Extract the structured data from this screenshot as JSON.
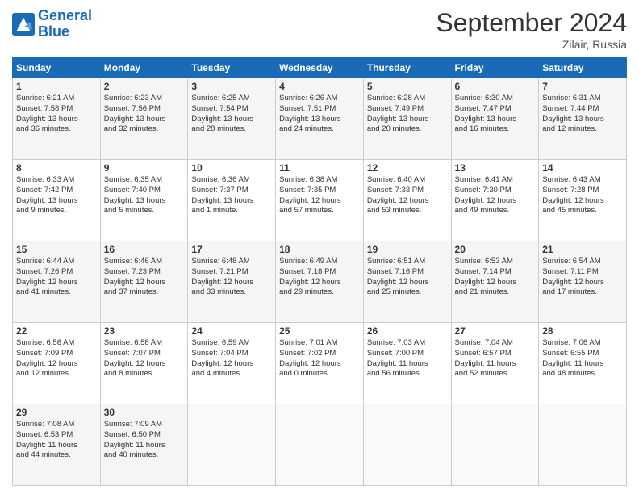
{
  "logo": {
    "line1": "General",
    "line2": "Blue"
  },
  "title": "September 2024",
  "location": "Zilair, Russia",
  "days_header": [
    "Sunday",
    "Monday",
    "Tuesday",
    "Wednesday",
    "Thursday",
    "Friday",
    "Saturday"
  ],
  "weeks": [
    [
      {
        "day": "1",
        "lines": [
          "Sunrise: 6:21 AM",
          "Sunset: 7:58 PM",
          "Daylight: 13 hours",
          "and 36 minutes."
        ]
      },
      {
        "day": "2",
        "lines": [
          "Sunrise: 6:23 AM",
          "Sunset: 7:56 PM",
          "Daylight: 13 hours",
          "and 32 minutes."
        ]
      },
      {
        "day": "3",
        "lines": [
          "Sunrise: 6:25 AM",
          "Sunset: 7:54 PM",
          "Daylight: 13 hours",
          "and 28 minutes."
        ]
      },
      {
        "day": "4",
        "lines": [
          "Sunrise: 6:26 AM",
          "Sunset: 7:51 PM",
          "Daylight: 13 hours",
          "and 24 minutes."
        ]
      },
      {
        "day": "5",
        "lines": [
          "Sunrise: 6:28 AM",
          "Sunset: 7:49 PM",
          "Daylight: 13 hours",
          "and 20 minutes."
        ]
      },
      {
        "day": "6",
        "lines": [
          "Sunrise: 6:30 AM",
          "Sunset: 7:47 PM",
          "Daylight: 13 hours",
          "and 16 minutes."
        ]
      },
      {
        "day": "7",
        "lines": [
          "Sunrise: 6:31 AM",
          "Sunset: 7:44 PM",
          "Daylight: 13 hours",
          "and 12 minutes."
        ]
      }
    ],
    [
      {
        "day": "8",
        "lines": [
          "Sunrise: 6:33 AM",
          "Sunset: 7:42 PM",
          "Daylight: 13 hours",
          "and 9 minutes."
        ]
      },
      {
        "day": "9",
        "lines": [
          "Sunrise: 6:35 AM",
          "Sunset: 7:40 PM",
          "Daylight: 13 hours",
          "and 5 minutes."
        ]
      },
      {
        "day": "10",
        "lines": [
          "Sunrise: 6:36 AM",
          "Sunset: 7:37 PM",
          "Daylight: 13 hours",
          "and 1 minute."
        ]
      },
      {
        "day": "11",
        "lines": [
          "Sunrise: 6:38 AM",
          "Sunset: 7:35 PM",
          "Daylight: 12 hours",
          "and 57 minutes."
        ]
      },
      {
        "day": "12",
        "lines": [
          "Sunrise: 6:40 AM",
          "Sunset: 7:33 PM",
          "Daylight: 12 hours",
          "and 53 minutes."
        ]
      },
      {
        "day": "13",
        "lines": [
          "Sunrise: 6:41 AM",
          "Sunset: 7:30 PM",
          "Daylight: 12 hours",
          "and 49 minutes."
        ]
      },
      {
        "day": "14",
        "lines": [
          "Sunrise: 6:43 AM",
          "Sunset: 7:28 PM",
          "Daylight: 12 hours",
          "and 45 minutes."
        ]
      }
    ],
    [
      {
        "day": "15",
        "lines": [
          "Sunrise: 6:44 AM",
          "Sunset: 7:26 PM",
          "Daylight: 12 hours",
          "and 41 minutes."
        ]
      },
      {
        "day": "16",
        "lines": [
          "Sunrise: 6:46 AM",
          "Sunset: 7:23 PM",
          "Daylight: 12 hours",
          "and 37 minutes."
        ]
      },
      {
        "day": "17",
        "lines": [
          "Sunrise: 6:48 AM",
          "Sunset: 7:21 PM",
          "Daylight: 12 hours",
          "and 33 minutes."
        ]
      },
      {
        "day": "18",
        "lines": [
          "Sunrise: 6:49 AM",
          "Sunset: 7:18 PM",
          "Daylight: 12 hours",
          "and 29 minutes."
        ]
      },
      {
        "day": "19",
        "lines": [
          "Sunrise: 6:51 AM",
          "Sunset: 7:16 PM",
          "Daylight: 12 hours",
          "and 25 minutes."
        ]
      },
      {
        "day": "20",
        "lines": [
          "Sunrise: 6:53 AM",
          "Sunset: 7:14 PM",
          "Daylight: 12 hours",
          "and 21 minutes."
        ]
      },
      {
        "day": "21",
        "lines": [
          "Sunrise: 6:54 AM",
          "Sunset: 7:11 PM",
          "Daylight: 12 hours",
          "and 17 minutes."
        ]
      }
    ],
    [
      {
        "day": "22",
        "lines": [
          "Sunrise: 6:56 AM",
          "Sunset: 7:09 PM",
          "Daylight: 12 hours",
          "and 12 minutes."
        ]
      },
      {
        "day": "23",
        "lines": [
          "Sunrise: 6:58 AM",
          "Sunset: 7:07 PM",
          "Daylight: 12 hours",
          "and 8 minutes."
        ]
      },
      {
        "day": "24",
        "lines": [
          "Sunrise: 6:59 AM",
          "Sunset: 7:04 PM",
          "Daylight: 12 hours",
          "and 4 minutes."
        ]
      },
      {
        "day": "25",
        "lines": [
          "Sunrise: 7:01 AM",
          "Sunset: 7:02 PM",
          "Daylight: 12 hours",
          "and 0 minutes."
        ]
      },
      {
        "day": "26",
        "lines": [
          "Sunrise: 7:03 AM",
          "Sunset: 7:00 PM",
          "Daylight: 11 hours",
          "and 56 minutes."
        ]
      },
      {
        "day": "27",
        "lines": [
          "Sunrise: 7:04 AM",
          "Sunset: 6:57 PM",
          "Daylight: 11 hours",
          "and 52 minutes."
        ]
      },
      {
        "day": "28",
        "lines": [
          "Sunrise: 7:06 AM",
          "Sunset: 6:55 PM",
          "Daylight: 11 hours",
          "and 48 minutes."
        ]
      }
    ],
    [
      {
        "day": "29",
        "lines": [
          "Sunrise: 7:08 AM",
          "Sunset: 6:53 PM",
          "Daylight: 11 hours",
          "and 44 minutes."
        ]
      },
      {
        "day": "30",
        "lines": [
          "Sunrise: 7:09 AM",
          "Sunset: 6:50 PM",
          "Daylight: 11 hours",
          "and 40 minutes."
        ]
      },
      {
        "day": "",
        "lines": []
      },
      {
        "day": "",
        "lines": []
      },
      {
        "day": "",
        "lines": []
      },
      {
        "day": "",
        "lines": []
      },
      {
        "day": "",
        "lines": []
      }
    ]
  ]
}
